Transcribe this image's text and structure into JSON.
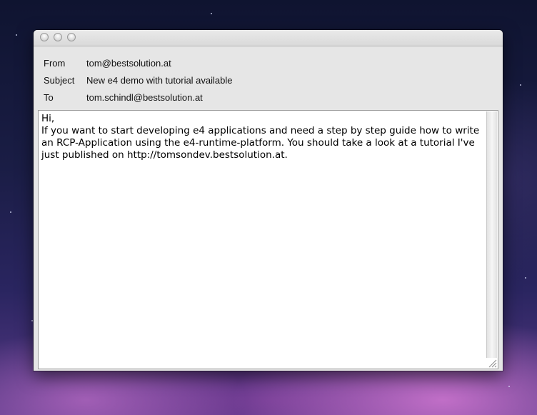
{
  "window": {
    "title": ""
  },
  "headers": [
    {
      "label": "From",
      "value": "tom@bestsolution.at"
    },
    {
      "label": "Subject",
      "value": "New e4 demo with tutorial available"
    },
    {
      "label": "To",
      "value": "tom.schindl@bestsolution.at"
    }
  ],
  "body": {
    "text": "Hi,\nIf you want to start developing e4 applications and need a step by step guide how to write an RCP-Application using the e4-runtime-platform. You should take a look at a tutorial I've just published on http://tomsondev.bestsolution.at."
  },
  "icons": {
    "close": "close-icon",
    "minimize": "minimize-icon",
    "zoom": "zoom-icon",
    "resize": "resize-grip-icon"
  }
}
